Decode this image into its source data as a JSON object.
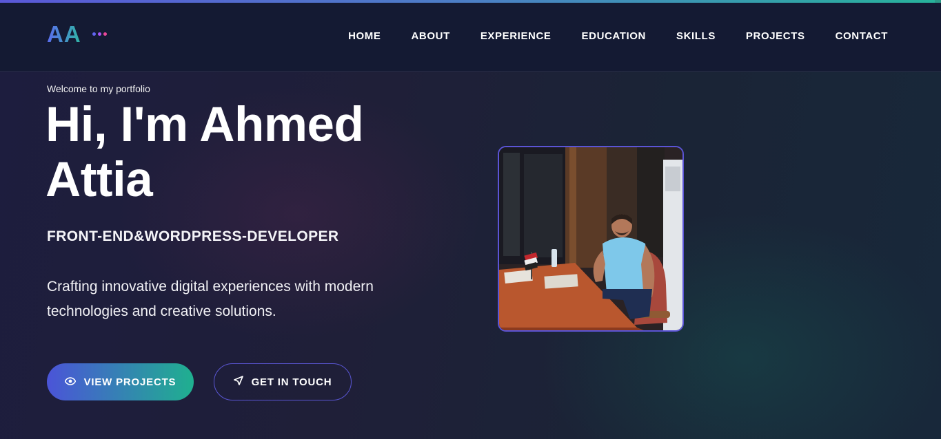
{
  "logo": {
    "text": "AA",
    "dot_colors": [
      "#6366f1",
      "#a855f7",
      "#ec4899"
    ]
  },
  "nav": {
    "items": [
      {
        "label": "HOME"
      },
      {
        "label": "ABOUT"
      },
      {
        "label": "EXPERIENCE"
      },
      {
        "label": "EDUCATION"
      },
      {
        "label": "SKILLS"
      },
      {
        "label": "PROJECTS"
      },
      {
        "label": "CONTACT"
      }
    ]
  },
  "hero": {
    "welcome": "Welcome to my portfolio",
    "title": "Hi, I'm Ahmed Attia",
    "role": "FRONT-END&WORDPRESS-DEVELOPER",
    "description": "Crafting innovative digital experiences with modern technologies and creative solutions.",
    "primary_button": {
      "label": "VIEW PROJECTS",
      "icon": "eye-icon"
    },
    "secondary_button": {
      "label": "GET IN TOUCH",
      "icon": "send-icon"
    }
  },
  "profile_photo": {
    "alt": "Ahmed Attia"
  },
  "colors": {
    "accent_start": "#4b54d8",
    "accent_end": "#1fb08f",
    "header_bg": "#141a33",
    "background": "#1f1f38"
  }
}
